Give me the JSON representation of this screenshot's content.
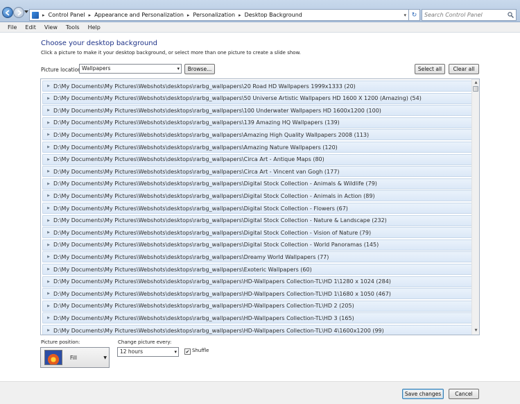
{
  "address_bar": {
    "crumbs": [
      "Control Panel",
      "Appearance and Personalization",
      "Personalization",
      "Desktop Background"
    ],
    "search_placeholder": "Search Control Panel"
  },
  "menu": [
    "File",
    "Edit",
    "View",
    "Tools",
    "Help"
  ],
  "main": {
    "title": "Choose your desktop background",
    "description": "Click a picture to make it your desktop background, or select more than one picture to create a slide show.",
    "picture_location_label": "Picture location:",
    "picture_location_value": "Wallpapers",
    "browse_label": "Browse...",
    "select_all_label": "Select all",
    "clear_all_label": "Clear all",
    "folders": [
      "D:\\My Documents\\My Pictures\\Webshots\\desktops\\rarbg_wallpapers\\20 Road HD Wallpapers 1999x1333 (20)",
      "D:\\My Documents\\My Pictures\\Webshots\\desktops\\rarbg_wallpapers\\50 Universe Artistic Wallpapers HD 1600 X 1200 (Amazing) (54)",
      "D:\\My Documents\\My Pictures\\Webshots\\desktops\\rarbg_wallpapers\\100 Underwater Wallpapers HD 1600x1200 (100)",
      "D:\\My Documents\\My Pictures\\Webshots\\desktops\\rarbg_wallpapers\\139 Amazing HQ Wallpapers (139)",
      "D:\\My Documents\\My Pictures\\Webshots\\desktops\\rarbg_wallpapers\\Amazing High Quality Wallpapers 2008 (113)",
      "D:\\My Documents\\My Pictures\\Webshots\\desktops\\rarbg_wallpapers\\Amazing Nature Wallpapers (120)",
      "D:\\My Documents\\My Pictures\\Webshots\\desktops\\rarbg_wallpapers\\Circa Art - Antique Maps (80)",
      "D:\\My Documents\\My Pictures\\Webshots\\desktops\\rarbg_wallpapers\\Circa Art - Vincent van Gogh (177)",
      "D:\\My Documents\\My Pictures\\Webshots\\desktops\\rarbg_wallpapers\\Digital Stock Collection  - Animals & Wildlife (79)",
      "D:\\My Documents\\My Pictures\\Webshots\\desktops\\rarbg_wallpapers\\Digital Stock Collection - Animals in Action (89)",
      "D:\\My Documents\\My Pictures\\Webshots\\desktops\\rarbg_wallpapers\\Digital Stock Collection - Flowers (67)",
      "D:\\My Documents\\My Pictures\\Webshots\\desktops\\rarbg_wallpapers\\Digital Stock Collection - Nature & Landscape (232)",
      "D:\\My Documents\\My Pictures\\Webshots\\desktops\\rarbg_wallpapers\\Digital Stock Collection - Vision of Nature (79)",
      "D:\\My Documents\\My Pictures\\Webshots\\desktops\\rarbg_wallpapers\\Digital Stock Collection - World Panoramas (145)",
      "D:\\My Documents\\My Pictures\\Webshots\\desktops\\rarbg_wallpapers\\Dreamy World Wallpapers (77)",
      "D:\\My Documents\\My Pictures\\Webshots\\desktops\\rarbg_wallpapers\\Exoteric Wallpapers (60)",
      "D:\\My Documents\\My Pictures\\Webshots\\desktops\\rarbg_wallpapers\\HD-Wallpapers Collection-TL\\HD 1\\1280 x 1024 (284)",
      "D:\\My Documents\\My Pictures\\Webshots\\desktops\\rarbg_wallpapers\\HD-Wallpapers Collection-TL\\HD 1\\1680 x 1050 (467)",
      "D:\\My Documents\\My Pictures\\Webshots\\desktops\\rarbg_wallpapers\\HD-Wallpapers Collection-TL\\HD 2 (205)",
      "D:\\My Documents\\My Pictures\\Webshots\\desktops\\rarbg_wallpapers\\HD-Wallpapers Collection-TL\\HD 3 (165)",
      "D:\\My Documents\\My Pictures\\Webshots\\desktops\\rarbg_wallpapers\\HD-Wallpapers Collection-TL\\HD 4\\1600x1200 (99)"
    ],
    "picture_position_label": "Picture position:",
    "picture_position_value": "Fill",
    "change_every_label": "Change picture every:",
    "change_every_value": "12 hours",
    "shuffle_label": "Shuffle",
    "shuffle_checked": true
  },
  "footer": {
    "save_label": "Save changes",
    "cancel_label": "Cancel"
  }
}
